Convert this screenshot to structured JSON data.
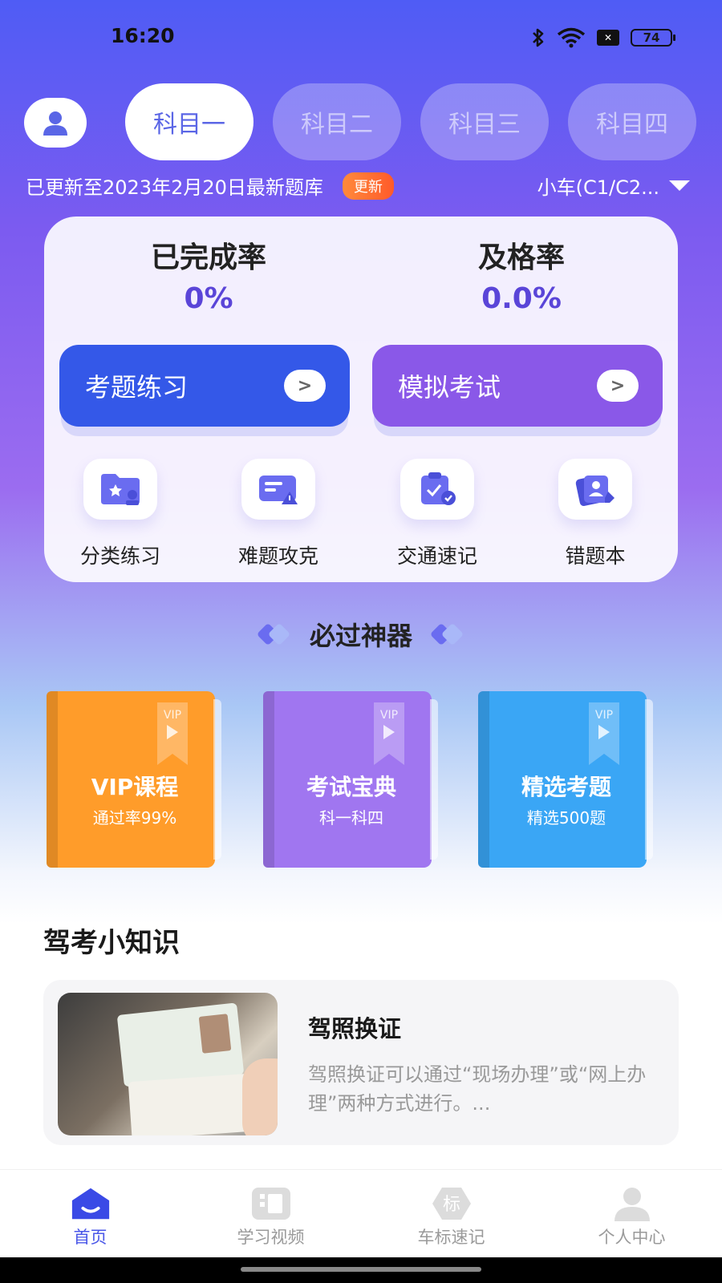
{
  "status_bar": {
    "time": "16:20",
    "battery": "74",
    "sim": "✕"
  },
  "tabs": [
    {
      "label": "科目一",
      "active": true
    },
    {
      "label": "科目二",
      "active": false
    },
    {
      "label": "科目三",
      "active": false
    },
    {
      "label": "科目四",
      "active": false
    }
  ],
  "update": {
    "text": "已更新至2023年2月20日最新题库",
    "badge": "更新"
  },
  "car_type": "小车(C1/C2...",
  "stats": {
    "completion_label": "已完成率",
    "completion_value": "0%",
    "pass_label": "及格率",
    "pass_value": "0.0%"
  },
  "buttons": {
    "practice": "考题练习",
    "exam": "模拟考试",
    "arrow": ">"
  },
  "features": [
    "分类练习",
    "难题攻克",
    "交通速记",
    "错题本"
  ],
  "section_title": "必过神器",
  "books": [
    {
      "title": "VIP课程",
      "subtitle": "通过率99%",
      "tag": "VIP",
      "color": "#ff9c2a"
    },
    {
      "title": "考试宝典",
      "subtitle": "科一科四",
      "tag": "VIP",
      "color": "#a076f0"
    },
    {
      "title": "精选考题",
      "subtitle": "精选500题",
      "tag": "VIP",
      "color": "#3aa6f5"
    }
  ],
  "tips_title": "驾考小知识",
  "article": {
    "title": "驾照换证",
    "desc": "驾照换证可以通过“现场办理”或“网上办理”两种方式进行。..."
  },
  "tabbar": [
    {
      "label": "首页",
      "icon": "home-icon",
      "active": true
    },
    {
      "label": "学习视频",
      "icon": "video-icon",
      "active": false
    },
    {
      "label": "车标速记",
      "icon": "car-logo-icon",
      "active": false
    },
    {
      "label": "个人中心",
      "icon": "profile-icon",
      "active": false
    }
  ]
}
